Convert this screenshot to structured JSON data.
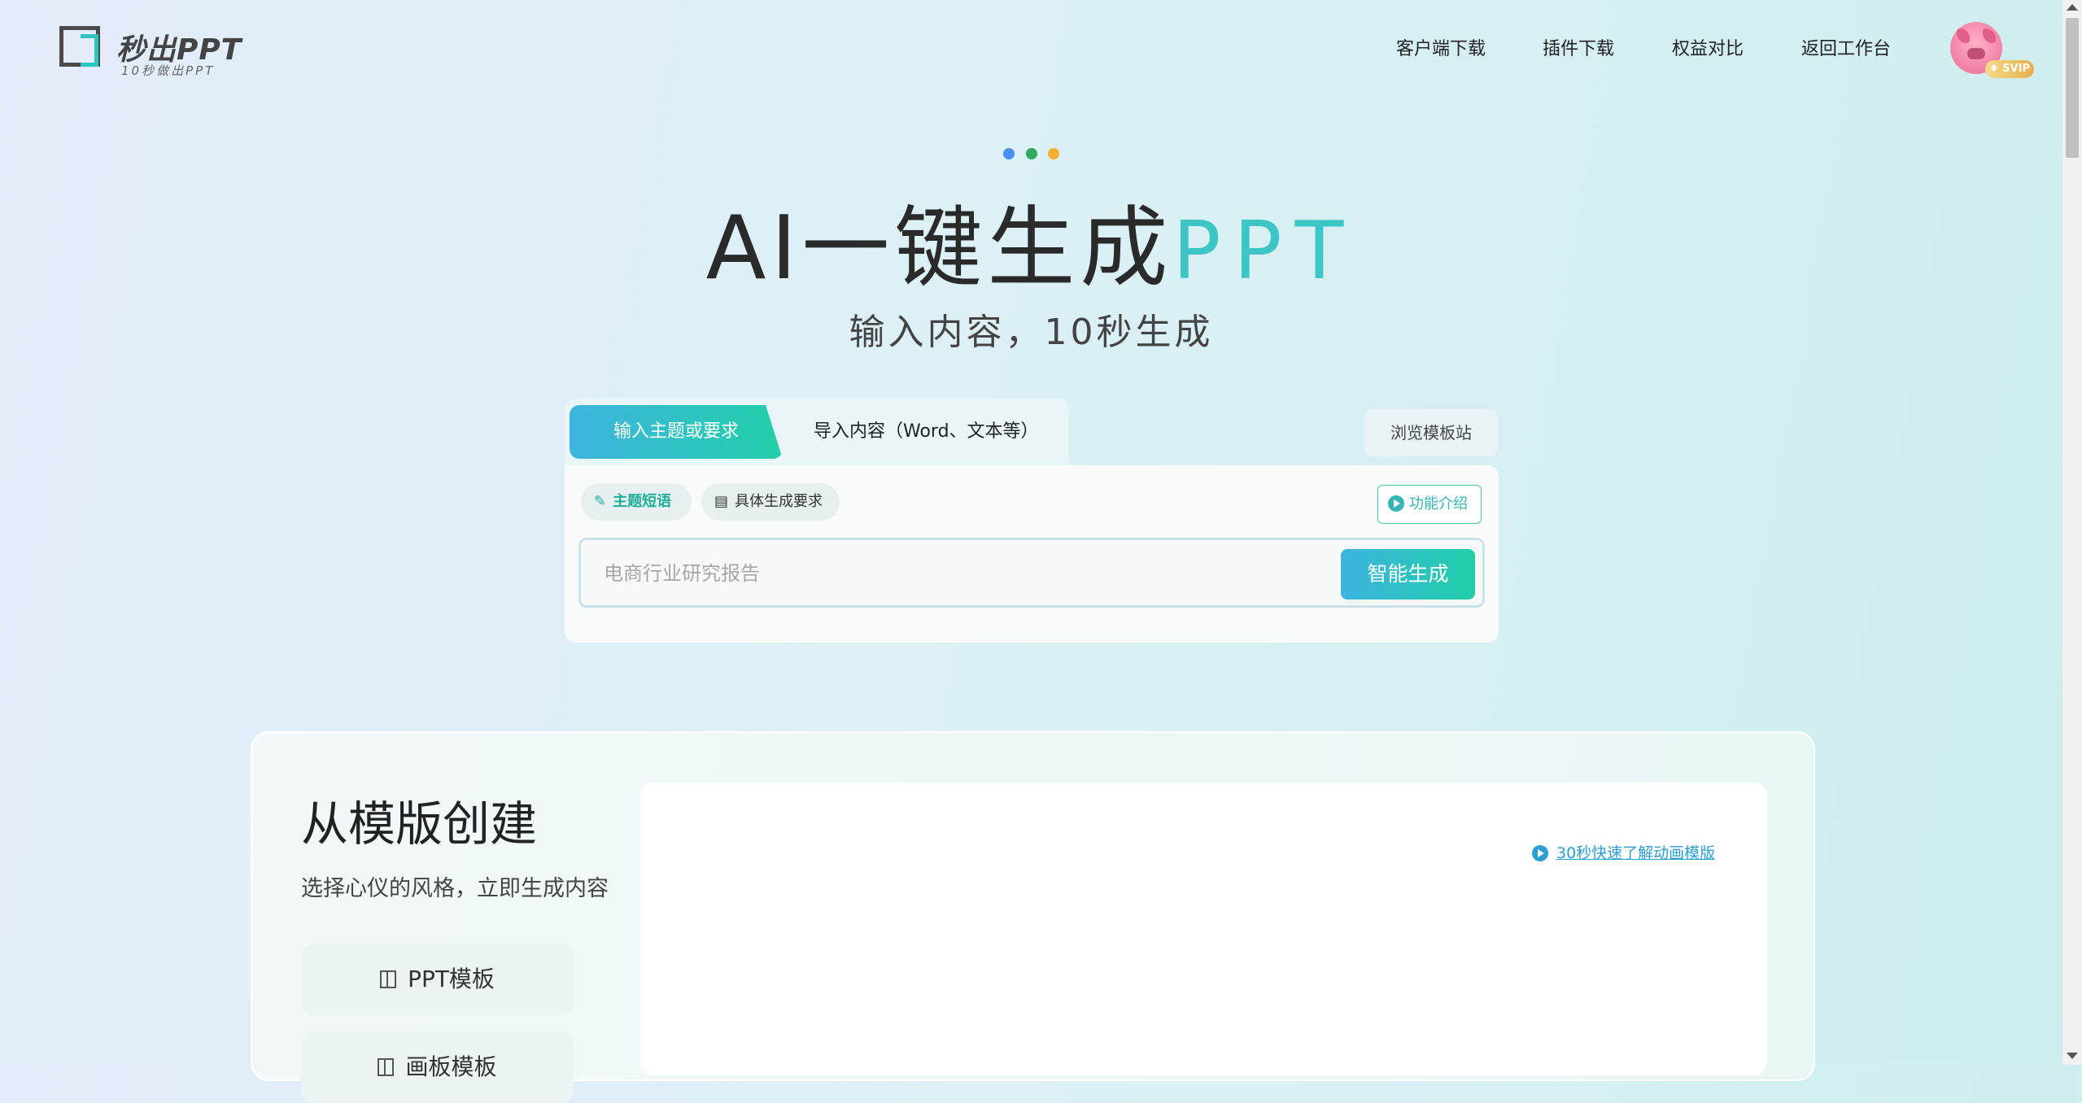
{
  "header": {
    "logo_text": "秒出PPT",
    "logo_sub": "10秒做出PPT",
    "nav": [
      "客户端下载",
      "插件下载",
      "权益对比",
      "返回工作台"
    ],
    "badge": "SVIP"
  },
  "hero": {
    "title_main": "AI一键生成",
    "title_accent": "PPT",
    "subtitle": "输入内容，10秒生成",
    "dot_colors": [
      "#4a8ef0",
      "#2faa5e",
      "#f2b02e"
    ]
  },
  "input_card": {
    "tabs": [
      "输入主题或要求",
      "导入内容（Word、文本等）"
    ],
    "browse": "浏览模板站",
    "chips": [
      "主题短语",
      "具体生成要求"
    ],
    "feature": "功能介绍",
    "placeholder": "电商行业研究报告",
    "generate": "智能生成"
  },
  "template_section": {
    "title": "从模版创建",
    "subtitle": "选择心仪的风格，立即生成内容",
    "items": [
      "PPT模板",
      "画板模板"
    ],
    "anim_link": "30秒快速了解动画模版"
  },
  "colors": {
    "accent": "#3ec6c6",
    "link": "#2b9fd6"
  }
}
